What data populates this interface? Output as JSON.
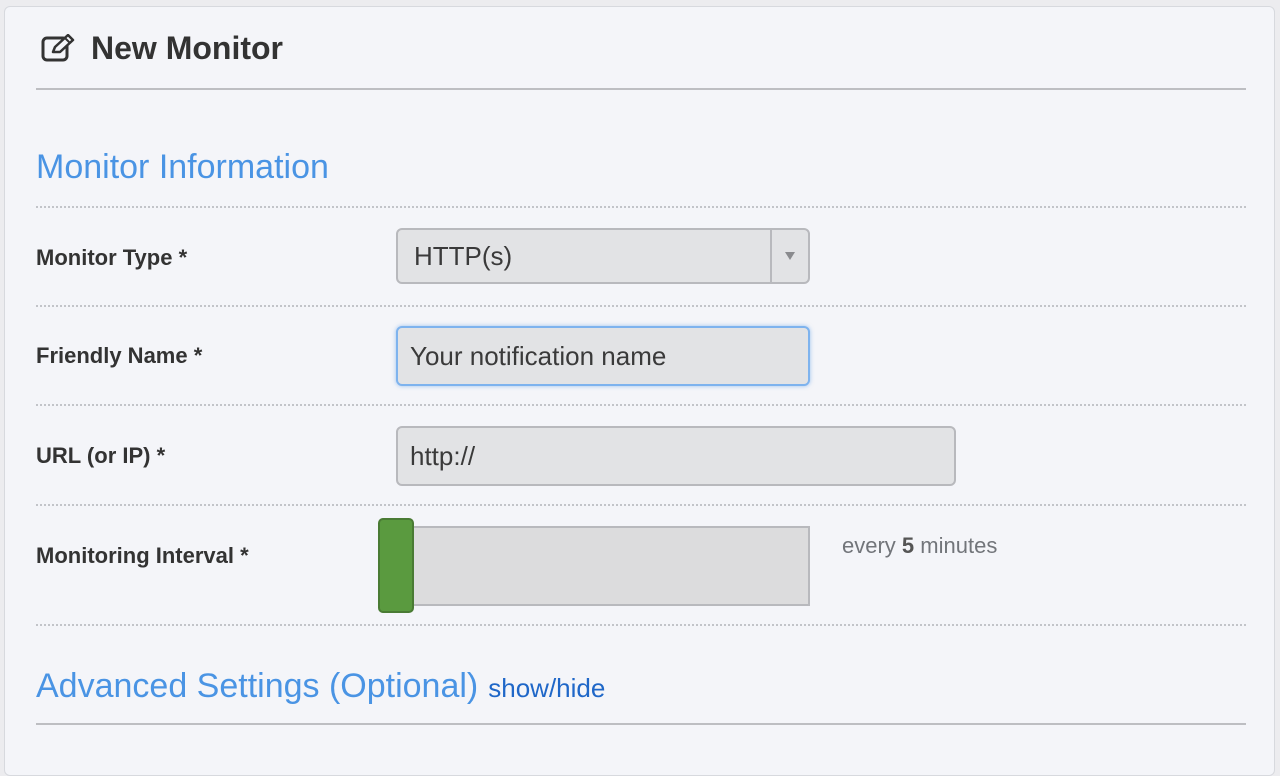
{
  "header": {
    "icon": "edit-icon",
    "title": "New Monitor"
  },
  "sections": {
    "monitor_information": "Monitor Information",
    "advanced_settings": "Advanced Settings (Optional)",
    "advanced_toggle": "show/hide"
  },
  "fields": {
    "monitor_type": {
      "label": "Monitor Type *",
      "selected": "HTTP(s)"
    },
    "friendly_name": {
      "label": "Friendly Name *",
      "value": "Your notification name"
    },
    "url": {
      "label": "URL (or IP) *",
      "value": "http://"
    },
    "monitoring_interval": {
      "label": "Monitoring Interval *",
      "prefix": "every ",
      "value": "5",
      "suffix": " minutes",
      "slider_position": 0
    }
  },
  "colors": {
    "heading_blue": "#4a94e4",
    "link_blue": "#1f67c8",
    "slider_green": "#5a9a3f"
  }
}
